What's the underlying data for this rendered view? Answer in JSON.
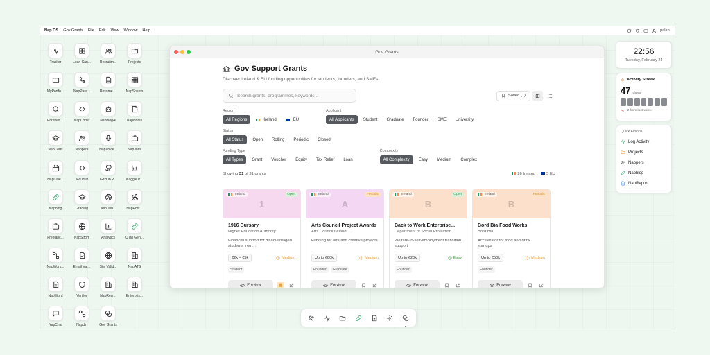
{
  "menubar": {
    "brand": "Nap OS",
    "items": [
      "Gov Grants",
      "File",
      "Edit",
      "View",
      "Window",
      "Help"
    ],
    "user": "palani"
  },
  "desktop_icons": [
    {
      "label": "Tracker",
      "icon": "activity-icon"
    },
    {
      "label": "Lean Can...",
      "icon": "grid-icon"
    },
    {
      "label": "Recruitm...",
      "icon": "users-icon"
    },
    {
      "label": "Projects",
      "icon": "folder-icon"
    },
    {
      "label": "MyPortfo...",
      "icon": "wallet-icon"
    },
    {
      "label": "NapPara...",
      "icon": "translate-icon"
    },
    {
      "label": "Resume ...",
      "icon": "document-icon"
    },
    {
      "label": "NapSheets",
      "icon": "table-icon"
    },
    {
      "label": "Portfolio ...",
      "icon": "search-icon"
    },
    {
      "label": "NapCoder",
      "icon": "code-icon"
    },
    {
      "label": "NapblogAI",
      "icon": "bot-icon"
    },
    {
      "label": "NapNotes",
      "icon": "note-icon"
    },
    {
      "label": "NapCerts",
      "icon": "graduation-icon"
    },
    {
      "label": "Nappers",
      "icon": "users-icon"
    },
    {
      "label": "NapVoice...",
      "icon": "mic-icon"
    },
    {
      "label": "NapJobs",
      "icon": "briefcase-icon"
    },
    {
      "label": "NapCale...",
      "icon": "calendar-icon"
    },
    {
      "label": "API Hub",
      "icon": "code-icon"
    },
    {
      "label": "GitHub P...",
      "icon": "github-icon"
    },
    {
      "label": "Kaggle P...",
      "icon": "chart-icon"
    },
    {
      "label": "Napblog",
      "icon": "link-icon"
    },
    {
      "label": "Grading",
      "icon": "graduation-icon"
    },
    {
      "label": "NapDrib...",
      "icon": "dribbble-icon"
    },
    {
      "label": "NapPost...",
      "icon": "fan-icon"
    },
    {
      "label": "Freelanc...",
      "icon": "briefcase-icon"
    },
    {
      "label": "NapStrom",
      "icon": "globe-icon"
    },
    {
      "label": "Analytics",
      "icon": "chart-icon"
    },
    {
      "label": "UTM Gen...",
      "icon": "link-icon"
    },
    {
      "label": "NapWork...",
      "icon": "workflow-icon"
    },
    {
      "label": "Email Val...",
      "icon": "file-check-icon"
    },
    {
      "label": "Site Valid...",
      "icon": "globe-icon"
    },
    {
      "label": "NapATS",
      "icon": "building-icon"
    },
    {
      "label": "NapWord",
      "icon": "document-icon"
    },
    {
      "label": "Verifier",
      "icon": "shield-icon"
    },
    {
      "label": "NapRecr...",
      "icon": "building-icon"
    },
    {
      "label": "Enterpris...",
      "icon": "building-icon"
    },
    {
      "label": "NapChat",
      "icon": "chat-icon"
    },
    {
      "label": "Napdin",
      "icon": "workflow-icon"
    },
    {
      "label": "Gov Grants",
      "icon": "coins-icon"
    }
  ],
  "window": {
    "title": "Gov Grants",
    "page_title": "Gov Support Grants",
    "subtitle": "Discover Ireland & EU funding opportunities for students, founders, and SMEs",
    "search_placeholder": "Search grants, programmes, keywords...",
    "saved_label": "Saved (1)",
    "filters": {
      "region": {
        "label": "Region",
        "options": [
          "All Regions",
          "Ireland",
          "EU"
        ],
        "active": 0
      },
      "applicant": {
        "label": "Applicant",
        "options": [
          "All Applicants",
          "Student",
          "Graduate",
          "Founder",
          "SME",
          "University"
        ],
        "active": 0
      },
      "status": {
        "label": "Status",
        "options": [
          "All Status",
          "Open",
          "Rolling",
          "Periodic",
          "Closed"
        ],
        "active": 0
      },
      "funding_type": {
        "label": "Funding Type",
        "options": [
          "All Types",
          "Grant",
          "Voucher",
          "Equity",
          "Tax Relief",
          "Loan"
        ],
        "active": 0
      },
      "complexity": {
        "label": "Complexity",
        "options": [
          "All Complexity",
          "Easy",
          "Medium",
          "Complex"
        ],
        "active": 0
      }
    },
    "showing": {
      "prefix": "Showing",
      "count": "31",
      "suffix": "of 31 grants",
      "ireland": "26 Ireland",
      "eu": "5 EU"
    },
    "preview_label": "Preview",
    "cards": [
      {
        "region": "Ireland",
        "status": "Open",
        "letter": "1",
        "title": "1916 Bursary",
        "org": "Higher Education Authority",
        "desc": "Financial support for disadvantaged students from...",
        "amount": "€2k – €5k",
        "level": "Medium",
        "tags": [
          "Student"
        ],
        "banner": "#f6d9ee",
        "status_bg": "#d8f3dc",
        "status_fg": "#3c9a55",
        "saved": true
      },
      {
        "region": "Ireland",
        "status": "Periodic",
        "letter": "A",
        "title": "Arts Council Project Awards",
        "org": "Arts Council Ireland",
        "desc": "Funding for arts and creative projects",
        "amount": "Up to €80k",
        "level": "Medium",
        "tags": [
          "Founder",
          "Graduate"
        ],
        "banner": "#f4d7f3",
        "status_bg": "#fde3c4",
        "status_fg": "#d98a2b",
        "saved": false
      },
      {
        "region": "Ireland",
        "status": "Open",
        "letter": "B",
        "title": "Back to Work Enterprise...",
        "org": "Department of Social Protection",
        "desc": "Welfare-to-self-employment transition support",
        "amount": "Up to €20k",
        "level": "Easy",
        "tags": [
          "Founder"
        ],
        "banner": "#fde0cc",
        "status_bg": "#d8f3dc",
        "status_fg": "#3c9a55",
        "saved": false
      },
      {
        "region": "Ireland",
        "status": "Periodic",
        "letter": "B",
        "title": "Bord Bia Food Works",
        "org": "Bord Bia",
        "desc": "Accelerator for food and drink startups",
        "amount": "Up to €50k",
        "level": "Medium",
        "tags": [
          "Founder"
        ],
        "banner": "#fde0cc",
        "status_bg": "#fde3c4",
        "status_fg": "#d98a2b",
        "saved": false
      }
    ]
  },
  "clock": {
    "time": "22:56",
    "date": "Tuesday, February 24"
  },
  "streak": {
    "title": "Activity Streak",
    "days": "47",
    "unit": "days",
    "footer": "-2 from last week"
  },
  "quick_actions": {
    "title": "Quick Actions",
    "items": [
      "Log Activity",
      "Projects",
      "Nappers",
      "Napblog",
      "NapReport"
    ]
  },
  "colors": {
    "accent_chip": "#55595e",
    "mac_red": "#ff5f57",
    "mac_yellow": "#febc2e",
    "mac_green": "#28c840"
  }
}
